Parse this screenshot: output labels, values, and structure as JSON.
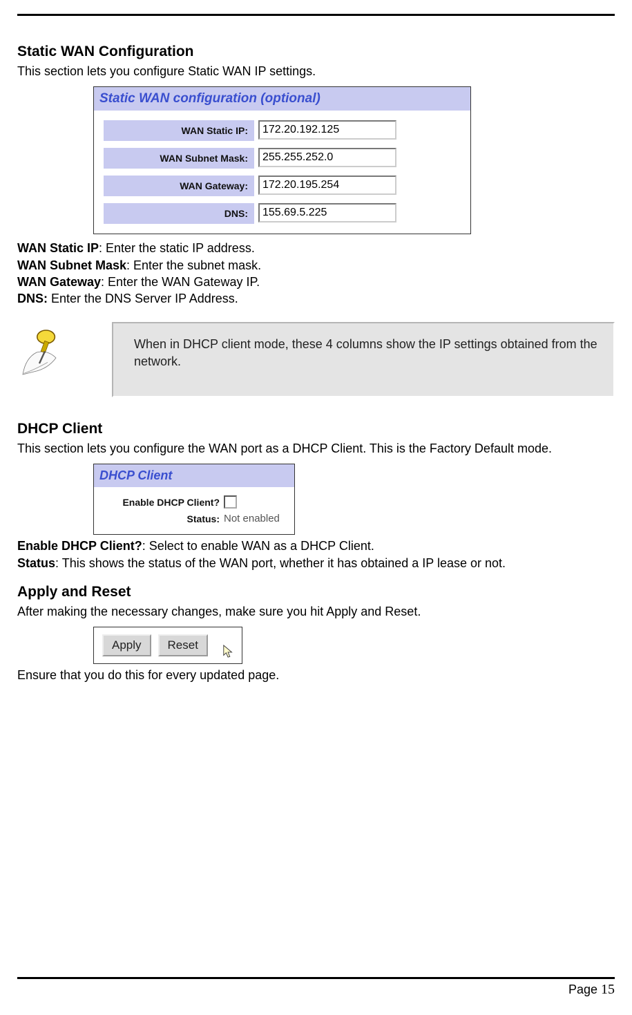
{
  "sections": {
    "static_wan": {
      "heading": "Static WAN Configuration",
      "intro": "This section lets you configure Static WAN IP settings.",
      "panel_title": "Static WAN configuration (optional)",
      "fields": {
        "wan_static_ip": {
          "label": "WAN Static IP:",
          "value": "172.20.192.125"
        },
        "wan_subnet_mask": {
          "label": "WAN Subnet Mask:",
          "value": "255.255.252.0"
        },
        "wan_gateway": {
          "label": "WAN Gateway:",
          "value": "172.20.195.254"
        },
        "dns": {
          "label": "DNS:",
          "value": "155.69.5.225"
        }
      },
      "definitions": {
        "d1_term": "WAN Static IP",
        "d1_desc": ": Enter the static IP address.",
        "d2_term": "WAN Subnet Mask",
        "d2_desc": ": Enter the subnet mask.",
        "d3_term": "WAN Gateway",
        "d3_desc": ": Enter the WAN Gateway IP.",
        "d4_term": "DNS:",
        "d4_desc": " Enter the DNS Server IP Address."
      },
      "note_text": "When in DHCP client mode, these 4 columns show the IP settings obtained from the network."
    },
    "dhcp_client": {
      "heading": "DHCP Client",
      "intro": "This section lets you configure the WAN port as a DHCP Client. This is the Factory Default mode.",
      "panel_title": "DHCP Client",
      "enable_label": "Enable DHCP Client?",
      "status_label": "Status:",
      "status_value": "Not enabled",
      "definitions": {
        "d1_term": "Enable DHCP Client?",
        "d1_desc": ": Select to enable WAN as a DHCP Client.",
        "d2_term": "Status",
        "d2_desc": ": This shows the status of the WAN port, whether it has obtained a IP lease or not."
      }
    },
    "apply_reset": {
      "heading": "Apply and Reset",
      "intro": "After making the necessary changes, make sure you hit Apply and Reset.",
      "apply_label": "Apply",
      "reset_label": "Reset",
      "outro": "Ensure that you do this for every updated page."
    }
  },
  "footer": {
    "page_label": "Page ",
    "page_number": "15"
  }
}
